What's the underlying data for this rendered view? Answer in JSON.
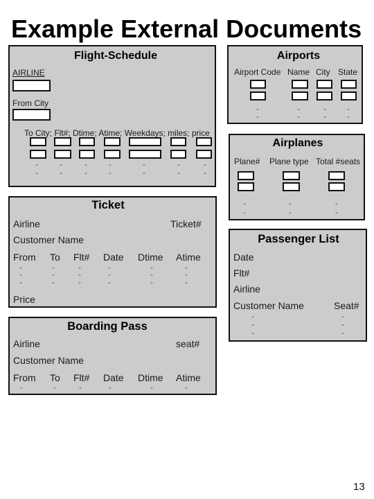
{
  "page": {
    "title": "Example External Documents",
    "page_number": "13"
  },
  "flight_schedule": {
    "title": "Flight-Schedule",
    "airline": {
      "label": "AIRLINE",
      "value": ""
    },
    "from_city": {
      "label": "From City",
      "value": ""
    },
    "columns_header": "To City; Flt#; Dtime; Atime; Weekdays; miles; price",
    "rows": [
      [
        "",
        "",
        "",
        "",
        "",
        "",
        ""
      ],
      [
        "",
        "",
        "",
        "",
        "",
        "",
        ""
      ]
    ],
    "continuation_rows": [
      [
        "-",
        "-",
        "-",
        "-",
        "-",
        "-",
        "-"
      ],
      [
        "-",
        "-",
        "-",
        "-",
        "-",
        "-",
        "-"
      ]
    ]
  },
  "airports": {
    "title": "Airports",
    "columns": [
      "Airport Code",
      "Name",
      "City",
      "State"
    ],
    "rows": [
      [
        "",
        "",
        "",
        ""
      ],
      [
        "",
        "",
        "",
        ""
      ]
    ],
    "continuation_rows": [
      [
        "-",
        "-",
        "-",
        "-"
      ],
      [
        "-",
        "-",
        "-",
        "-"
      ]
    ]
  },
  "airplanes": {
    "title": "Airplanes",
    "columns": [
      "Plane#",
      "Plane type",
      "Total #seats"
    ],
    "rows": [
      [
        "",
        "",
        ""
      ],
      [
        "",
        "",
        ""
      ]
    ],
    "continuation_rows": [
      [
        "-",
        "-",
        "-"
      ],
      [
        "-",
        "-",
        "-"
      ]
    ]
  },
  "ticket": {
    "title": "Ticket",
    "airline_label": "Airline",
    "ticket_no_label": "Ticket#",
    "customer_name_label": "Customer Name",
    "columns": [
      "From",
      "To",
      "Flt#",
      "Date",
      "Dtime",
      "Atime"
    ],
    "continuation_rows": [
      [
        "-",
        "-",
        "-",
        "-",
        "-",
        "-"
      ],
      [
        "-",
        "-",
        "-",
        "-",
        "-",
        "-"
      ],
      [
        "-",
        "-",
        "-",
        "-",
        "-",
        "-"
      ]
    ],
    "price_label": "Price"
  },
  "passenger_list": {
    "title": "Passenger List",
    "date_label": "Date",
    "flt_label": "Flt#",
    "airline_label": "Airline",
    "columns": [
      "Customer Name",
      "Seat#"
    ],
    "continuation_rows": [
      [
        "-",
        "-"
      ],
      [
        "-",
        "-"
      ],
      [
        "-",
        "-"
      ]
    ]
  },
  "boarding_pass": {
    "title": "Boarding Pass",
    "airline_label": "Airline",
    "seat_label": "seat#",
    "customer_name_label": "Customer Name",
    "columns": [
      "From",
      "To",
      "Flt#",
      "Date",
      "Dtime",
      "Atime"
    ],
    "continuation_rows": [
      [
        "-",
        "-",
        "-",
        "-",
        "-",
        "-"
      ]
    ]
  }
}
